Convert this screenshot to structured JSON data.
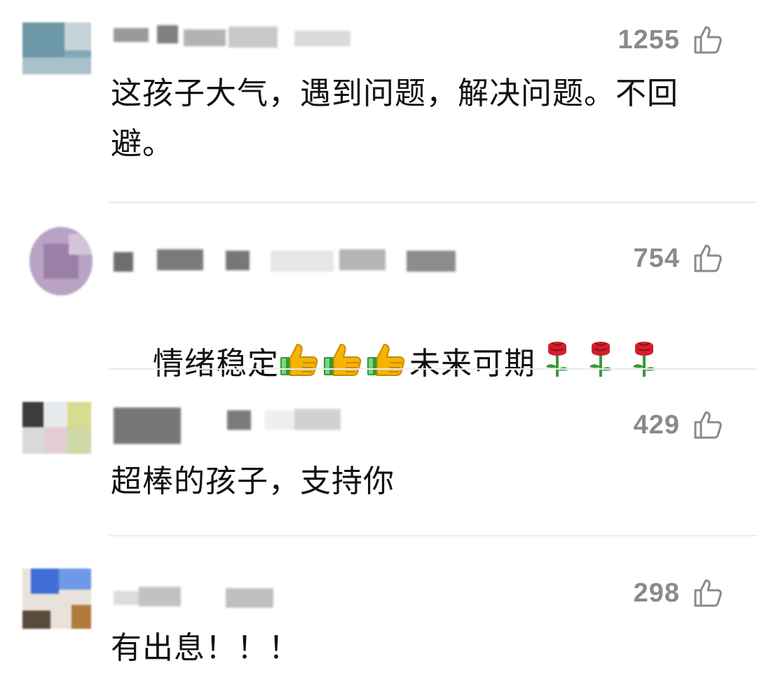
{
  "comments": [
    {
      "likes": "1255",
      "text": "这孩子大气，遇到问题，解决问题。不回避。",
      "like_icon": "thumbs-up-outline-icon"
    },
    {
      "likes": "754",
      "text_prefix": "情绪稳定",
      "text_middle": "未来可期",
      "emojis": [
        "thumbs-up-emoji",
        "thumbs-up-emoji",
        "thumbs-up-emoji",
        "rose-emoji",
        "rose-emoji",
        "rose-emoji"
      ],
      "like_icon": "thumbs-up-outline-icon"
    },
    {
      "likes": "429",
      "text": "超棒的孩子，支持你",
      "like_icon": "thumbs-up-outline-icon"
    },
    {
      "likes": "298",
      "text": "有出息！！！",
      "like_icon": "thumbs-up-outline-icon"
    }
  ],
  "colors": {
    "like_count": "#8a8a8a",
    "text": "#111111",
    "divider": "#ececec"
  }
}
